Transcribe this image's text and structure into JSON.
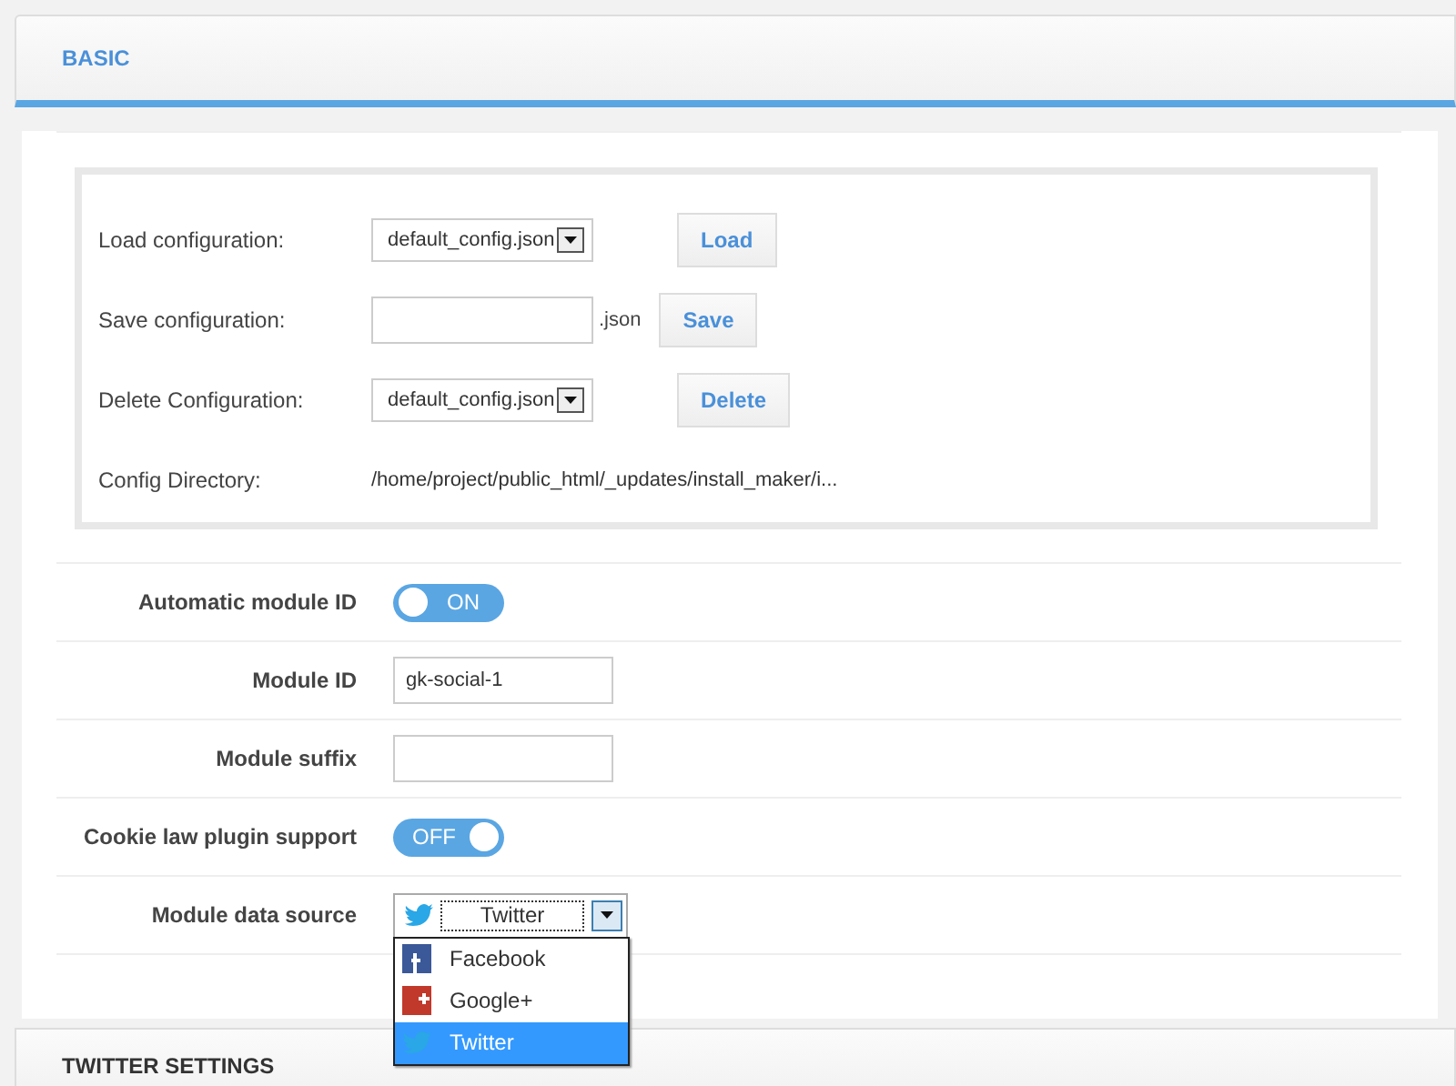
{
  "header": {
    "title": "BASIC"
  },
  "config": {
    "rows": [
      {
        "kind": "select",
        "label": "Load configuration:",
        "value": "default_config.json",
        "button": "Load"
      },
      {
        "kind": "input",
        "label": "Save configuration:",
        "suffix": ".json",
        "button": "Save"
      },
      {
        "kind": "select",
        "label": "Delete Configuration:",
        "value": "default_config.json",
        "button": "Delete"
      },
      {
        "kind": "text",
        "label": "Config Directory:",
        "value": "/home/project/public_html/_updates/install_maker/i..."
      }
    ]
  },
  "fields": [
    {
      "kind": "toggle",
      "label": "Automatic module ID",
      "on": true,
      "text": "ON"
    },
    {
      "kind": "input",
      "label": "Module ID",
      "value": "gk-social-1"
    },
    {
      "kind": "input",
      "label": "Module suffix"
    },
    {
      "kind": "toggle",
      "label": "Cookie law plugin support",
      "on": false,
      "text": "OFF"
    },
    {
      "kind": "source",
      "label": "Module data source",
      "value": "Twitter",
      "expanded": true,
      "options": [
        {
          "label": "Facebook",
          "kind": "tile",
          "selected": false
        },
        {
          "label": "Google+",
          "kind": "plus",
          "selected": false
        },
        {
          "label": "Twitter",
          "kind": "bird",
          "selected": true
        }
      ]
    }
  ],
  "next_section": {
    "title": "TWITTER SETTINGS"
  }
}
